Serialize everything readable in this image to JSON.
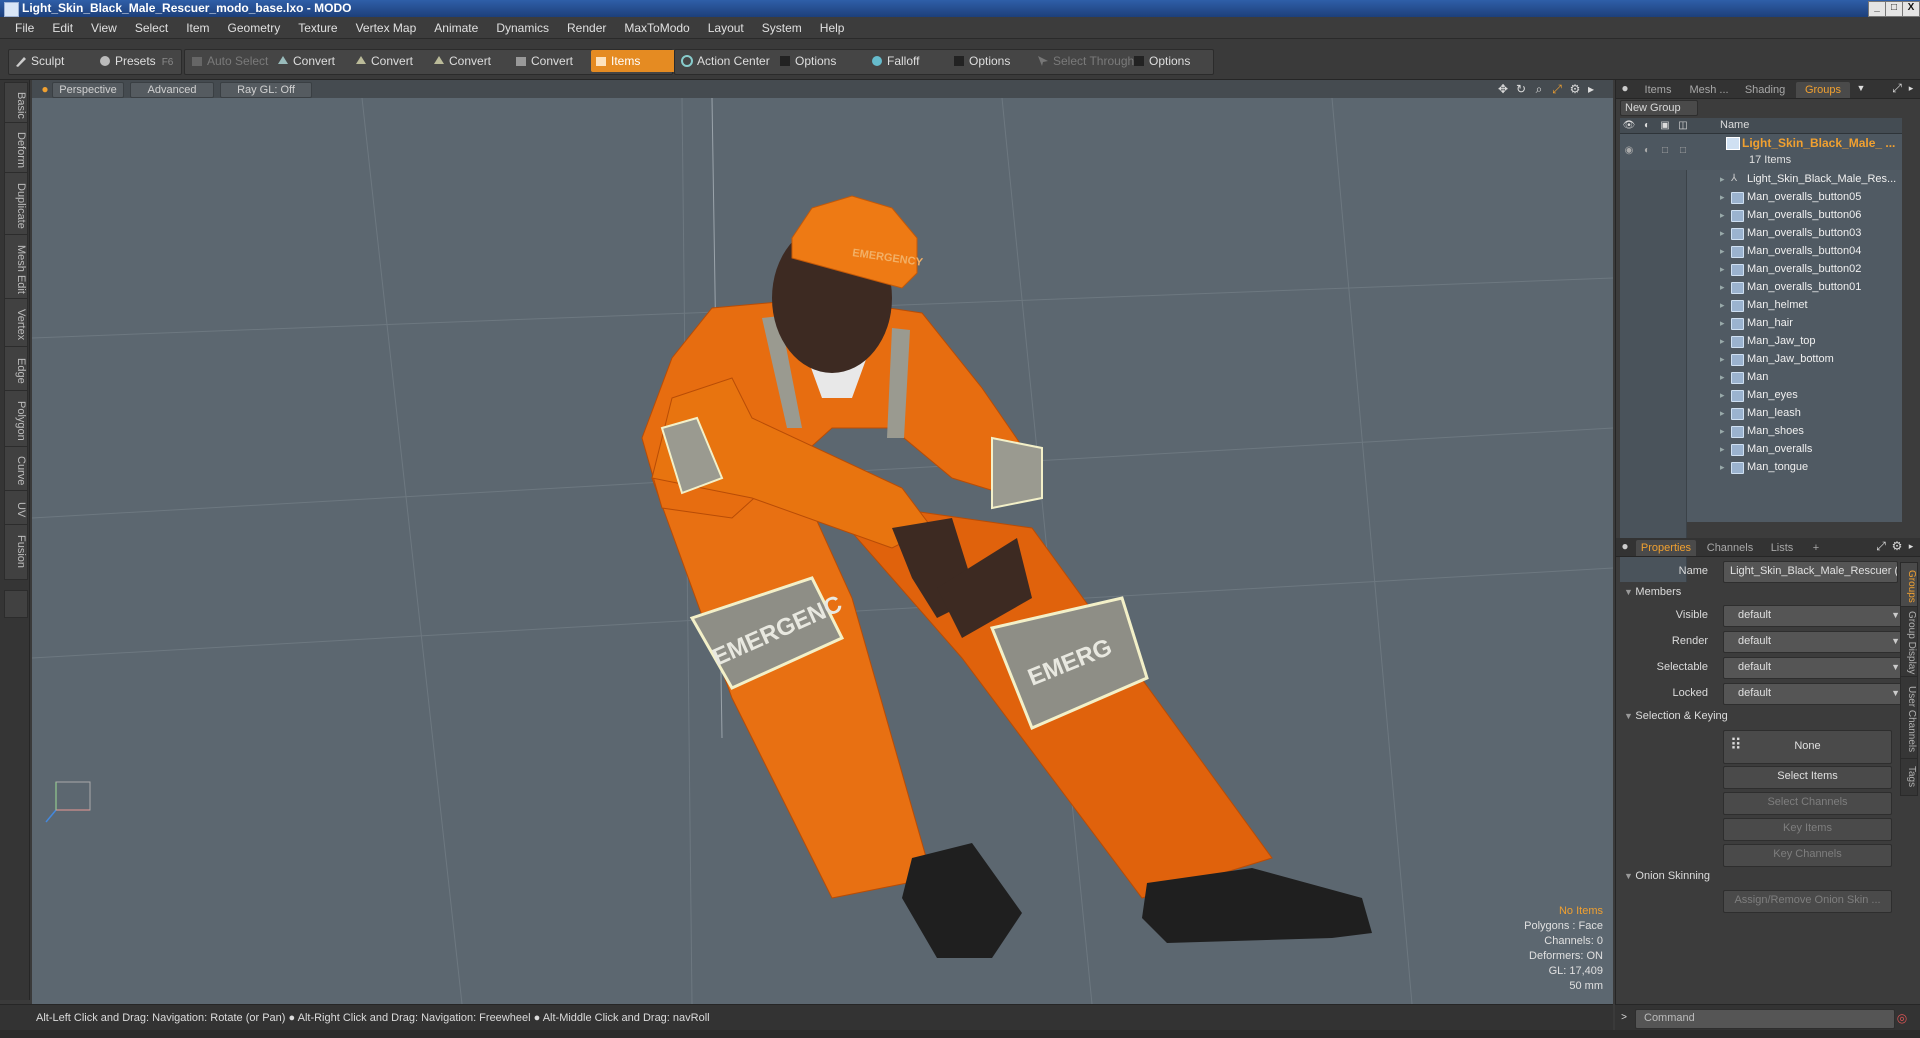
{
  "window": {
    "title": "Light_Skin_Black_Male_Rescuer_modo_base.lxo - MODO",
    "controls": [
      "_",
      "□",
      "X"
    ]
  },
  "menu": [
    "File",
    "Edit",
    "View",
    "Select",
    "Item",
    "Geometry",
    "Texture",
    "Vertex Map",
    "Animate",
    "Dynamics",
    "Render",
    "MaxToModo",
    "Layout",
    "System",
    "Help"
  ],
  "toolbar": {
    "sculpt": "Sculpt",
    "presets": "Presets",
    "presets_key": "F6",
    "auto_select": "Auto Select",
    "convert": "Convert",
    "items": "Items",
    "action_center": "Action Center",
    "options": "Options",
    "falloff": "Falloff",
    "select_through": "Select Through"
  },
  "left_tabs": [
    "Basic",
    "Deform",
    "Duplicate",
    "Mesh Edit",
    "Vertex",
    "Edge",
    "Polygon",
    "Curve",
    "UV",
    "Fusion"
  ],
  "viewport": {
    "tabs": [
      "Perspective",
      "Advanced",
      "Ray GL: Off"
    ],
    "info": {
      "selection": "No Items",
      "polygons": "Polygons : Face",
      "channels": "Channels: 0",
      "deformers": "Deformers: ON",
      "gl": "GL: 17,409",
      "scale": "50 mm"
    },
    "helmet_text": "EMERGENCY",
    "leg_text_left": "EMERGENC",
    "leg_text_right": "EMERG"
  },
  "items_panel": {
    "tabs": [
      "Items",
      "Mesh ...",
      "Shading",
      "Groups"
    ],
    "active_tab": "Groups",
    "new_group": "New Group",
    "column_name": "Name",
    "group_name": "Light_Skin_Black_Male_ ...",
    "group_count": "17 Items",
    "items": [
      "Light_Skin_Black_Male_Res...",
      "Man_overalls_button05",
      "Man_overalls_button06",
      "Man_overalls_button03",
      "Man_overalls_button04",
      "Man_overalls_button02",
      "Man_overalls_button01",
      "Man_helmet",
      "Man_hair",
      "Man_Jaw_top",
      "Man_Jaw_bottom",
      "Man",
      "Man_eyes",
      "Man_leash",
      "Man_shoes",
      "Man_overalls",
      "Man_tongue"
    ]
  },
  "properties_panel": {
    "tabs": [
      "Properties",
      "Channels",
      "Lists",
      "+"
    ],
    "active_tab": "Properties",
    "name_label": "Name",
    "name_value": "Light_Skin_Black_Male_Rescuer (",
    "members_section": "Members",
    "fields": [
      {
        "label": "Visible",
        "value": "default"
      },
      {
        "label": "Render",
        "value": "default"
      },
      {
        "label": "Selectable",
        "value": "default"
      },
      {
        "label": "Locked",
        "value": "default"
      }
    ],
    "selection_section": "Selection & Keying",
    "none_button": "None",
    "buttons": [
      "Select Items",
      "Select Channels",
      "Key Items",
      "Key Channels"
    ],
    "onion_section": "Onion Skinning",
    "onion_button": "Assign/Remove Onion Skin ...",
    "side_tabs": [
      "Groups",
      "Group Display",
      "User Channels",
      "Tags"
    ]
  },
  "status_bar": {
    "hint1": "Alt-Left Click and Drag: Navigation: Rotate (or Pan)",
    "hint2": "Alt-Right Click and Drag: Navigation: Freewheel",
    "hint3": "Alt-Middle Click and Drag: navRoll"
  },
  "command": {
    "placeholder": "Command"
  },
  "colors": {
    "accent": "#e58b22",
    "viewport_bg": "#5c6770",
    "suit": "#e0620c"
  }
}
